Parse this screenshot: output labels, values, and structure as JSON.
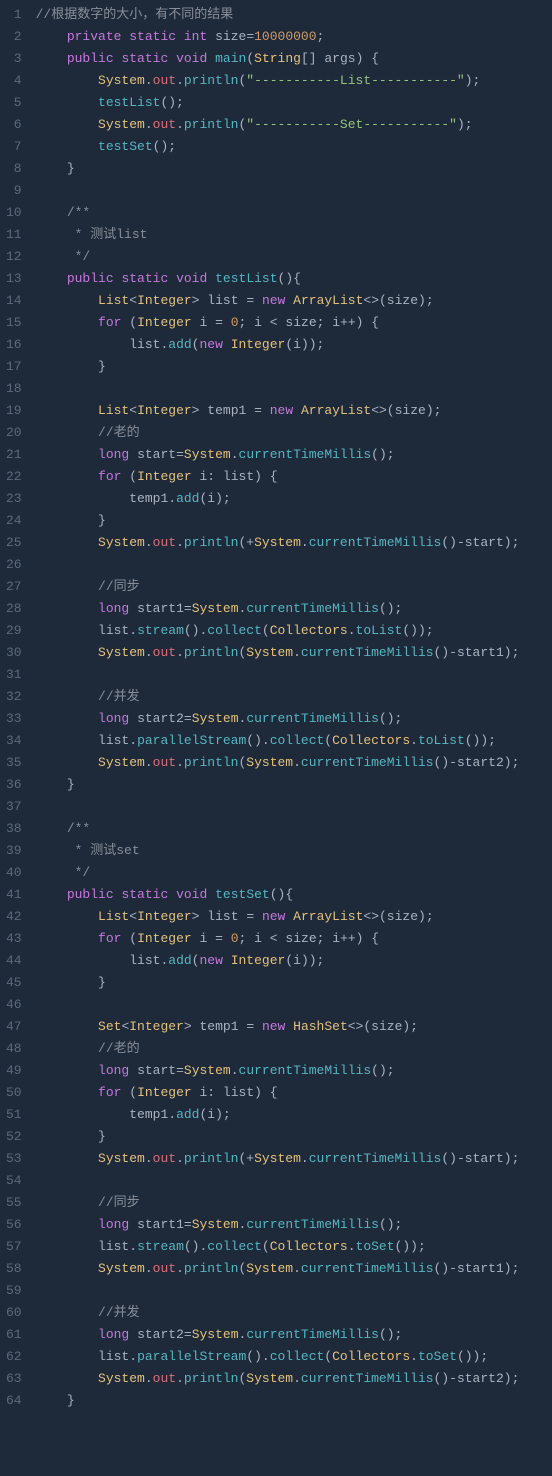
{
  "code_lines": [
    {
      "n": 1,
      "html": "<span class='c-comment'>//根据数字的大小，有不同的结果</span>"
    },
    {
      "n": 2,
      "html": "    <span class='c-key'>private</span> <span class='c-key'>static</span> <span class='c-type'>int</span> <span class='c-name'>size</span><span class='c-punc'>=</span><span class='c-num'>10000000</span><span class='c-punc'>;</span>"
    },
    {
      "n": 3,
      "html": "    <span class='c-key'>public</span> <span class='c-key'>static</span> <span class='c-type'>void</span> <span class='c-func'>main</span><span class='c-punc'>(</span><span class='c-class'>String</span><span class='c-punc'>[]</span> <span class='c-name'>args</span><span class='c-punc'>)</span> <span class='c-punc'>{</span>"
    },
    {
      "n": 4,
      "html": "        <span class='c-class'>System</span><span class='c-punc'>.</span><span class='c-prop'>out</span><span class='c-punc'>.</span><span class='c-func'>println</span><span class='c-punc'>(</span><span class='c-str'>\"-----------List-----------\"</span><span class='c-punc'>);</span>"
    },
    {
      "n": 5,
      "html": "        <span class='c-func'>testList</span><span class='c-punc'>();</span>"
    },
    {
      "n": 6,
      "html": "        <span class='c-class'>System</span><span class='c-punc'>.</span><span class='c-prop'>out</span><span class='c-punc'>.</span><span class='c-func'>println</span><span class='c-punc'>(</span><span class='c-str'>\"-----------Set-----------\"</span><span class='c-punc'>);</span>"
    },
    {
      "n": 7,
      "html": "        <span class='c-func'>testSet</span><span class='c-punc'>();</span>"
    },
    {
      "n": 8,
      "html": "    <span class='c-punc'>}</span>"
    },
    {
      "n": 9,
      "html": ""
    },
    {
      "n": 10,
      "html": "    <span class='c-comment'>/**</span>"
    },
    {
      "n": 11,
      "html": "<span class='c-comment'>     * 测试list</span>"
    },
    {
      "n": 12,
      "html": "<span class='c-comment'>     */</span>"
    },
    {
      "n": 13,
      "html": "    <span class='c-key'>public</span> <span class='c-key'>static</span> <span class='c-type'>void</span> <span class='c-func'>testList</span><span class='c-punc'>(){</span>"
    },
    {
      "n": 14,
      "html": "        <span class='c-class'>List</span><span class='c-punc'>&lt;</span><span class='c-class'>Integer</span><span class='c-punc'>&gt;</span> <span class='c-name'>list</span> <span class='c-punc'>=</span> <span class='c-key'>new</span> <span class='c-class'>ArrayList</span><span class='c-punc'>&lt;&gt;(</span><span class='c-name'>size</span><span class='c-punc'>);</span>"
    },
    {
      "n": 15,
      "html": "        <span class='c-key'>for</span> <span class='c-punc'>(</span><span class='c-class'>Integer</span> <span class='c-name'>i</span> <span class='c-punc'>=</span> <span class='c-num'>0</span><span class='c-punc'>;</span> <span class='c-name'>i</span> <span class='c-punc'>&lt;</span> <span class='c-name'>size</span><span class='c-punc'>;</span> <span class='c-name'>i</span><span class='c-punc'>++)</span> <span class='c-punc'>{</span>"
    },
    {
      "n": 16,
      "html": "            <span class='c-name'>list</span><span class='c-punc'>.</span><span class='c-func'>add</span><span class='c-punc'>(</span><span class='c-key'>new</span> <span class='c-class'>Integer</span><span class='c-punc'>(</span><span class='c-name'>i</span><span class='c-punc'>));</span>"
    },
    {
      "n": 17,
      "html": "        <span class='c-punc'>}</span>"
    },
    {
      "n": 18,
      "html": ""
    },
    {
      "n": 19,
      "html": "        <span class='c-class'>List</span><span class='c-punc'>&lt;</span><span class='c-class'>Integer</span><span class='c-punc'>&gt;</span> <span class='c-name'>temp1</span> <span class='c-punc'>=</span> <span class='c-key'>new</span> <span class='c-class'>ArrayList</span><span class='c-punc'>&lt;&gt;(</span><span class='c-name'>size</span><span class='c-punc'>);</span>"
    },
    {
      "n": 20,
      "html": "        <span class='c-comment'>//老的</span>"
    },
    {
      "n": 21,
      "html": "        <span class='c-type'>long</span> <span class='c-name'>start</span><span class='c-punc'>=</span><span class='c-class'>System</span><span class='c-punc'>.</span><span class='c-func'>currentTimeMillis</span><span class='c-punc'>();</span>"
    },
    {
      "n": 22,
      "html": "        <span class='c-key'>for</span> <span class='c-punc'>(</span><span class='c-class'>Integer</span> <span class='c-name'>i</span><span class='c-punc'>:</span> <span class='c-name'>list</span><span class='c-punc'>)</span> <span class='c-punc'>{</span>"
    },
    {
      "n": 23,
      "html": "            <span class='c-name'>temp1</span><span class='c-punc'>.</span><span class='c-func'>add</span><span class='c-punc'>(</span><span class='c-name'>i</span><span class='c-punc'>);</span>"
    },
    {
      "n": 24,
      "html": "        <span class='c-punc'>}</span>"
    },
    {
      "n": 25,
      "html": "        <span class='c-class'>System</span><span class='c-punc'>.</span><span class='c-prop'>out</span><span class='c-punc'>.</span><span class='c-func'>println</span><span class='c-punc'>(+</span><span class='c-class'>System</span><span class='c-punc'>.</span><span class='c-func'>currentTimeMillis</span><span class='c-punc'>()-</span><span class='c-name'>start</span><span class='c-punc'>);</span>"
    },
    {
      "n": 26,
      "html": ""
    },
    {
      "n": 27,
      "html": "        <span class='c-comment'>//同步</span>"
    },
    {
      "n": 28,
      "html": "        <span class='c-type'>long</span> <span class='c-name'>start1</span><span class='c-punc'>=</span><span class='c-class'>System</span><span class='c-punc'>.</span><span class='c-func'>currentTimeMillis</span><span class='c-punc'>();</span>"
    },
    {
      "n": 29,
      "html": "        <span class='c-name'>list</span><span class='c-punc'>.</span><span class='c-func'>stream</span><span class='c-punc'>().</span><span class='c-func'>collect</span><span class='c-punc'>(</span><span class='c-class'>Collectors</span><span class='c-punc'>.</span><span class='c-func'>toList</span><span class='c-punc'>());</span>"
    },
    {
      "n": 30,
      "html": "        <span class='c-class'>System</span><span class='c-punc'>.</span><span class='c-prop'>out</span><span class='c-punc'>.</span><span class='c-func'>println</span><span class='c-punc'>(</span><span class='c-class'>System</span><span class='c-punc'>.</span><span class='c-func'>currentTimeMillis</span><span class='c-punc'>()-</span><span class='c-name'>start1</span><span class='c-punc'>);</span>"
    },
    {
      "n": 31,
      "html": ""
    },
    {
      "n": 32,
      "html": "        <span class='c-comment'>//并发</span>"
    },
    {
      "n": 33,
      "html": "        <span class='c-type'>long</span> <span class='c-name'>start2</span><span class='c-punc'>=</span><span class='c-class'>System</span><span class='c-punc'>.</span><span class='c-func'>currentTimeMillis</span><span class='c-punc'>();</span>"
    },
    {
      "n": 34,
      "html": "        <span class='c-name'>list</span><span class='c-punc'>.</span><span class='c-func'>parallelStream</span><span class='c-punc'>().</span><span class='c-func'>collect</span><span class='c-punc'>(</span><span class='c-class'>Collectors</span><span class='c-punc'>.</span><span class='c-func'>toList</span><span class='c-punc'>());</span>"
    },
    {
      "n": 35,
      "html": "        <span class='c-class'>System</span><span class='c-punc'>.</span><span class='c-prop'>out</span><span class='c-punc'>.</span><span class='c-func'>println</span><span class='c-punc'>(</span><span class='c-class'>System</span><span class='c-punc'>.</span><span class='c-func'>currentTimeMillis</span><span class='c-punc'>()-</span><span class='c-name'>start2</span><span class='c-punc'>);</span>"
    },
    {
      "n": 36,
      "html": "    <span class='c-punc'>}</span>"
    },
    {
      "n": 37,
      "html": ""
    },
    {
      "n": 38,
      "html": "    <span class='c-comment'>/**</span>"
    },
    {
      "n": 39,
      "html": "<span class='c-comment'>     * 测试set</span>"
    },
    {
      "n": 40,
      "html": "<span class='c-comment'>     */</span>"
    },
    {
      "n": 41,
      "html": "    <span class='c-key'>public</span> <span class='c-key'>static</span> <span class='c-type'>void</span> <span class='c-func'>testSet</span><span class='c-punc'>(){</span>"
    },
    {
      "n": 42,
      "html": "        <span class='c-class'>List</span><span class='c-punc'>&lt;</span><span class='c-class'>Integer</span><span class='c-punc'>&gt;</span> <span class='c-name'>list</span> <span class='c-punc'>=</span> <span class='c-key'>new</span> <span class='c-class'>ArrayList</span><span class='c-punc'>&lt;&gt;(</span><span class='c-name'>size</span><span class='c-punc'>);</span>"
    },
    {
      "n": 43,
      "html": "        <span class='c-key'>for</span> <span class='c-punc'>(</span><span class='c-class'>Integer</span> <span class='c-name'>i</span> <span class='c-punc'>=</span> <span class='c-num'>0</span><span class='c-punc'>;</span> <span class='c-name'>i</span> <span class='c-punc'>&lt;</span> <span class='c-name'>size</span><span class='c-punc'>;</span> <span class='c-name'>i</span><span class='c-punc'>++)</span> <span class='c-punc'>{</span>"
    },
    {
      "n": 44,
      "html": "            <span class='c-name'>list</span><span class='c-punc'>.</span><span class='c-func'>add</span><span class='c-punc'>(</span><span class='c-key'>new</span> <span class='c-class'>Integer</span><span class='c-punc'>(</span><span class='c-name'>i</span><span class='c-punc'>));</span>"
    },
    {
      "n": 45,
      "html": "        <span class='c-punc'>}</span>"
    },
    {
      "n": 46,
      "html": ""
    },
    {
      "n": 47,
      "html": "        <span class='c-class'>Set</span><span class='c-punc'>&lt;</span><span class='c-class'>Integer</span><span class='c-punc'>&gt;</span> <span class='c-name'>temp1</span> <span class='c-punc'>=</span> <span class='c-key'>new</span> <span class='c-class'>HashSet</span><span class='c-punc'>&lt;&gt;(</span><span class='c-name'>size</span><span class='c-punc'>);</span>"
    },
    {
      "n": 48,
      "html": "        <span class='c-comment'>//老的</span>"
    },
    {
      "n": 49,
      "html": "        <span class='c-type'>long</span> <span class='c-name'>start</span><span class='c-punc'>=</span><span class='c-class'>System</span><span class='c-punc'>.</span><span class='c-func'>currentTimeMillis</span><span class='c-punc'>();</span>"
    },
    {
      "n": 50,
      "html": "        <span class='c-key'>for</span> <span class='c-punc'>(</span><span class='c-class'>Integer</span> <span class='c-name'>i</span><span class='c-punc'>:</span> <span class='c-name'>list</span><span class='c-punc'>)</span> <span class='c-punc'>{</span>"
    },
    {
      "n": 51,
      "html": "            <span class='c-name'>temp1</span><span class='c-punc'>.</span><span class='c-func'>add</span><span class='c-punc'>(</span><span class='c-name'>i</span><span class='c-punc'>);</span>"
    },
    {
      "n": 52,
      "html": "        <span class='c-punc'>}</span>"
    },
    {
      "n": 53,
      "html": "        <span class='c-class'>System</span><span class='c-punc'>.</span><span class='c-prop'>out</span><span class='c-punc'>.</span><span class='c-func'>println</span><span class='c-punc'>(+</span><span class='c-class'>System</span><span class='c-punc'>.</span><span class='c-func'>currentTimeMillis</span><span class='c-punc'>()-</span><span class='c-name'>start</span><span class='c-punc'>);</span>"
    },
    {
      "n": 54,
      "html": ""
    },
    {
      "n": 55,
      "html": "        <span class='c-comment'>//同步</span>"
    },
    {
      "n": 56,
      "html": "        <span class='c-type'>long</span> <span class='c-name'>start1</span><span class='c-punc'>=</span><span class='c-class'>System</span><span class='c-punc'>.</span><span class='c-func'>currentTimeMillis</span><span class='c-punc'>();</span>"
    },
    {
      "n": 57,
      "html": "        <span class='c-name'>list</span><span class='c-punc'>.</span><span class='c-func'>stream</span><span class='c-punc'>().</span><span class='c-func'>collect</span><span class='c-punc'>(</span><span class='c-class'>Collectors</span><span class='c-punc'>.</span><span class='c-func'>toSet</span><span class='c-punc'>());</span>"
    },
    {
      "n": 58,
      "html": "        <span class='c-class'>System</span><span class='c-punc'>.</span><span class='c-prop'>out</span><span class='c-punc'>.</span><span class='c-func'>println</span><span class='c-punc'>(</span><span class='c-class'>System</span><span class='c-punc'>.</span><span class='c-func'>currentTimeMillis</span><span class='c-punc'>()-</span><span class='c-name'>start1</span><span class='c-punc'>);</span>"
    },
    {
      "n": 59,
      "html": ""
    },
    {
      "n": 60,
      "html": "        <span class='c-comment'>//并发</span>"
    },
    {
      "n": 61,
      "html": "        <span class='c-type'>long</span> <span class='c-name'>start2</span><span class='c-punc'>=</span><span class='c-class'>System</span><span class='c-punc'>.</span><span class='c-func'>currentTimeMillis</span><span class='c-punc'>();</span>"
    },
    {
      "n": 62,
      "html": "        <span class='c-name'>list</span><span class='c-punc'>.</span><span class='c-func'>parallelStream</span><span class='c-punc'>().</span><span class='c-func'>collect</span><span class='c-punc'>(</span><span class='c-class'>Collectors</span><span class='c-punc'>.</span><span class='c-func'>toSet</span><span class='c-punc'>());</span>"
    },
    {
      "n": 63,
      "html": "        <span class='c-class'>System</span><span class='c-punc'>.</span><span class='c-prop'>out</span><span class='c-punc'>.</span><span class='c-func'>println</span><span class='c-punc'>(</span><span class='c-class'>System</span><span class='c-punc'>.</span><span class='c-func'>currentTimeMillis</span><span class='c-punc'>()-</span><span class='c-name'>start2</span><span class='c-punc'>);</span>"
    },
    {
      "n": 64,
      "html": "    <span class='c-punc'>}</span>"
    }
  ]
}
